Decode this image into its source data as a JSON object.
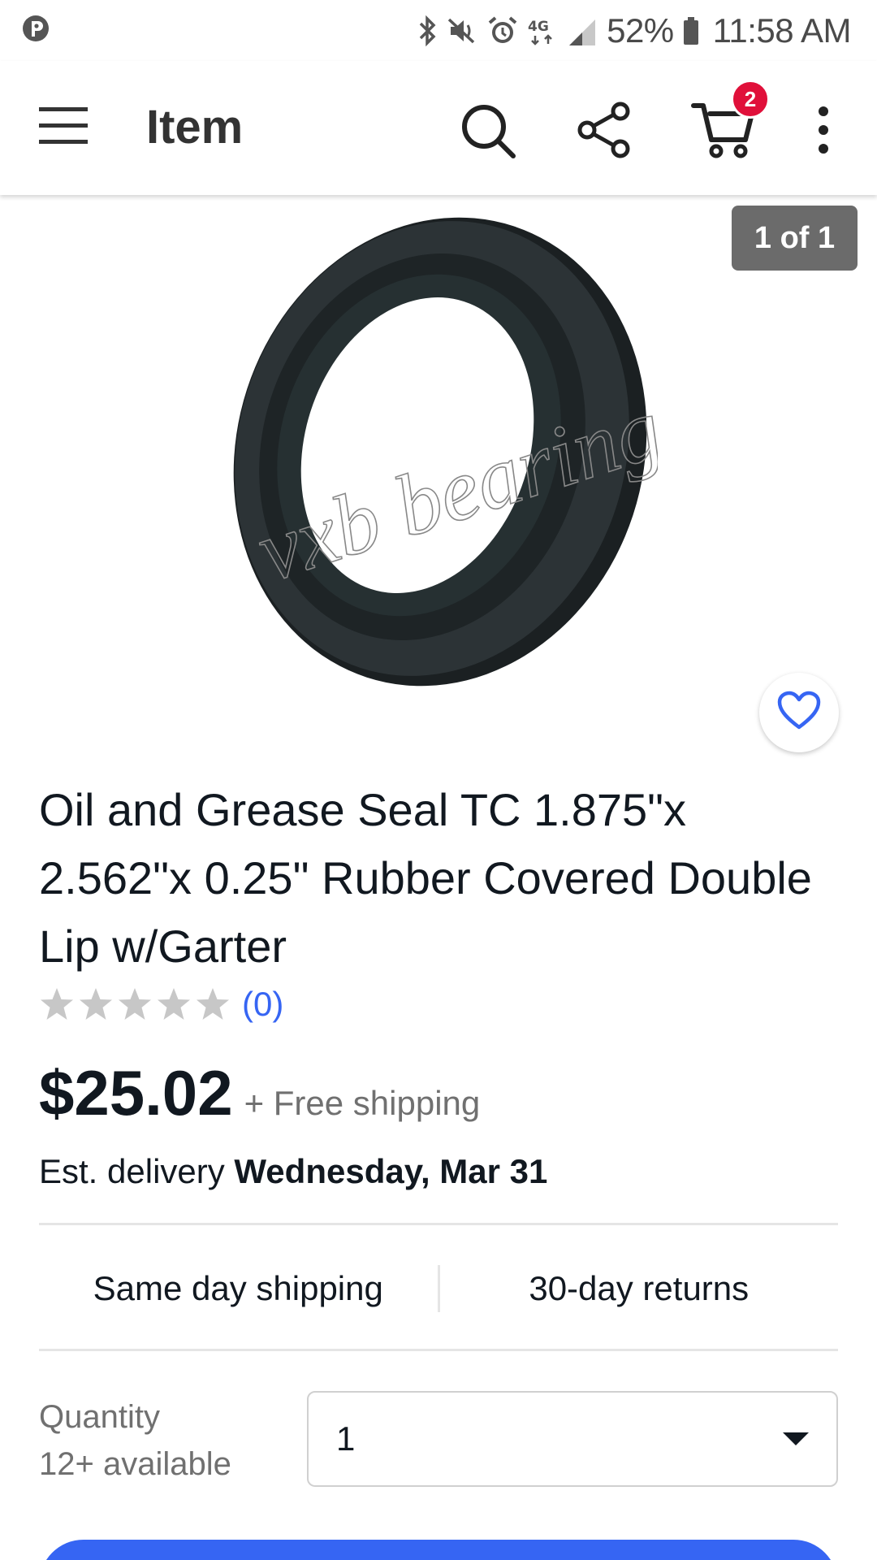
{
  "status_bar": {
    "battery": "52%",
    "time": "11:58 AM"
  },
  "app_bar": {
    "title": "Item",
    "cart_count": "2"
  },
  "gallery": {
    "counter": "1 of 1"
  },
  "product": {
    "title": "Oil and Grease Seal TC 1.875\"x 2.562\"x 0.25\" Rubber Covered Double Lip w/Garter",
    "rating_stars": 0,
    "review_count": "(0)",
    "price": "$25.02",
    "shipping": "+ Free shipping",
    "delivery_prefix": "Est. delivery ",
    "delivery_date": "Wednesday, Mar 31"
  },
  "features": {
    "left": "Same day shipping",
    "right": "30-day returns"
  },
  "quantity": {
    "label": "Quantity",
    "available": "12+ available",
    "selected": "1"
  },
  "colors": {
    "accent": "#3665f3",
    "badge": "#e0103a"
  }
}
